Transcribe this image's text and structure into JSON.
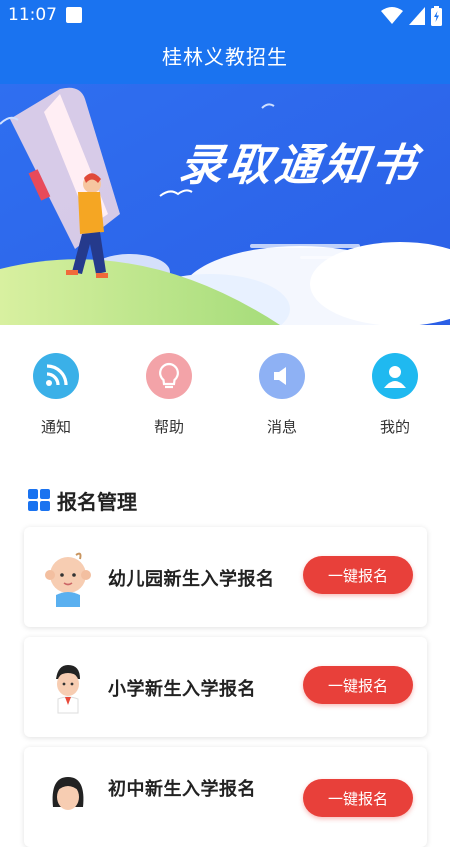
{
  "status_bar": {
    "time": "11:07"
  },
  "app_bar": {
    "title": "桂林义教招生"
  },
  "banner": {
    "title": "录取通知书"
  },
  "quick_menu": [
    {
      "label": "通知",
      "icon": "rss-icon",
      "color": "#3ab0e8"
    },
    {
      "label": "帮助",
      "icon": "lightbulb-icon",
      "color": "#f3a3a8"
    },
    {
      "label": "消息",
      "icon": "speaker-icon",
      "color": "#8eb1f4"
    },
    {
      "label": "我的",
      "icon": "user-icon",
      "color": "#1fb9f0"
    }
  ],
  "section": {
    "title": "报名管理",
    "icon": "grid-icon"
  },
  "cards": [
    {
      "title": "幼儿园新生入学报名",
      "button": "一键报名",
      "avatar": "baby-avatar"
    },
    {
      "title": "小学新生入学报名",
      "button": "一键报名",
      "avatar": "boy-avatar"
    },
    {
      "title": "初中新生入学报名",
      "button": "一键报名",
      "avatar": "girl-avatar"
    }
  ],
  "colors": {
    "primary": "#1a73f0",
    "button": "#e8403a"
  }
}
